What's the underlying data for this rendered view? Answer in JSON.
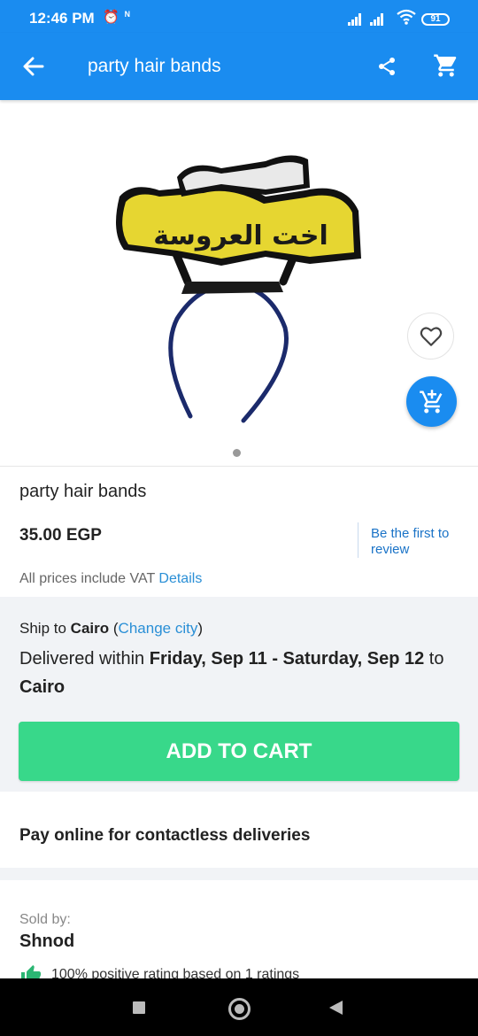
{
  "status_bar": {
    "time": "12:46 PM",
    "battery": "91"
  },
  "app_bar": {
    "title": "party hair bands"
  },
  "product": {
    "name": "party hair bands",
    "image_text": "اخت العروسة",
    "price": "35.00 EGP",
    "review_link": "Be the first to review",
    "vat_text": "All prices include VAT",
    "vat_link": "Details"
  },
  "shipping": {
    "ship_to_label": "Ship to",
    "city": "Cairo",
    "change_city": "Change city",
    "delivered_prefix": "Delivered within",
    "delivery_range": "Friday, Sep 11 - Saturday, Sep 12",
    "to_label": "to",
    "to_city": "Cairo"
  },
  "add_to_cart": "ADD TO CART",
  "pay_online": "Pay online for contactless deliveries",
  "seller": {
    "sold_by_label": "Sold by:",
    "name": "Shnod",
    "rating_text": "100% positive rating based on 1 ratings"
  },
  "colors": {
    "brand_blue": "#1a8cf0",
    "cart_green": "#38d88a",
    "link_blue": "#2a8fd6"
  }
}
